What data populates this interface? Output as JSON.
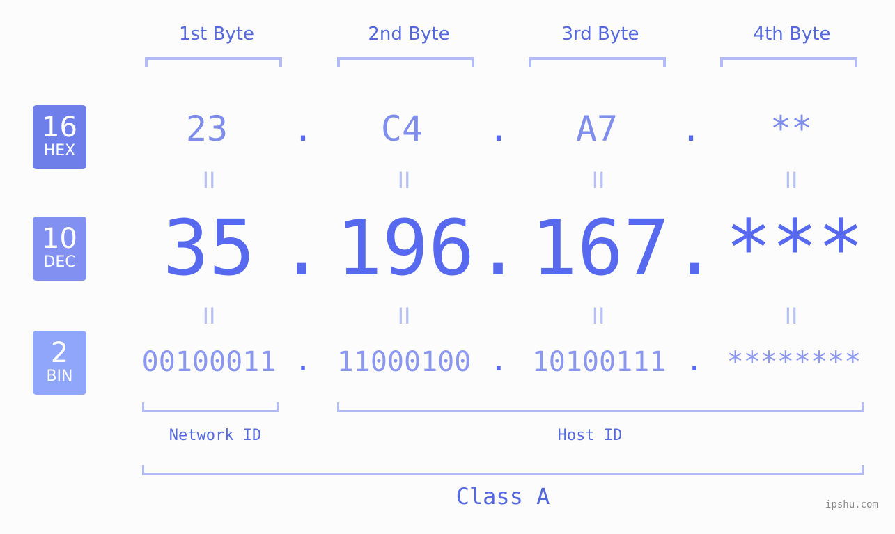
{
  "byte_headers": [
    "1st Byte",
    "2nd Byte",
    "3rd Byte",
    "4th Byte"
  ],
  "badges": {
    "hex": {
      "number": "16",
      "label": "HEX",
      "color": "#6f7fe9"
    },
    "dec": {
      "number": "10",
      "label": "DEC",
      "color": "#8190f1"
    },
    "bin": {
      "number": "2",
      "label": "BIN",
      "color": "#8fa6fa"
    }
  },
  "hex": [
    "23",
    "C4",
    "A7",
    "**"
  ],
  "dec": [
    "35",
    "196",
    "167",
    "***"
  ],
  "bin": [
    "00100011",
    "11000100",
    "10100111",
    "********"
  ],
  "separator": ".",
  "equals": "II",
  "network_id_label": "Network ID",
  "host_id_label": "Host ID",
  "class_label": "Class A",
  "watermark": "ipshu.com",
  "colors": {
    "primary": "#5669ef",
    "bracket": "#b2bbf6",
    "background": "#fbfcfb"
  }
}
